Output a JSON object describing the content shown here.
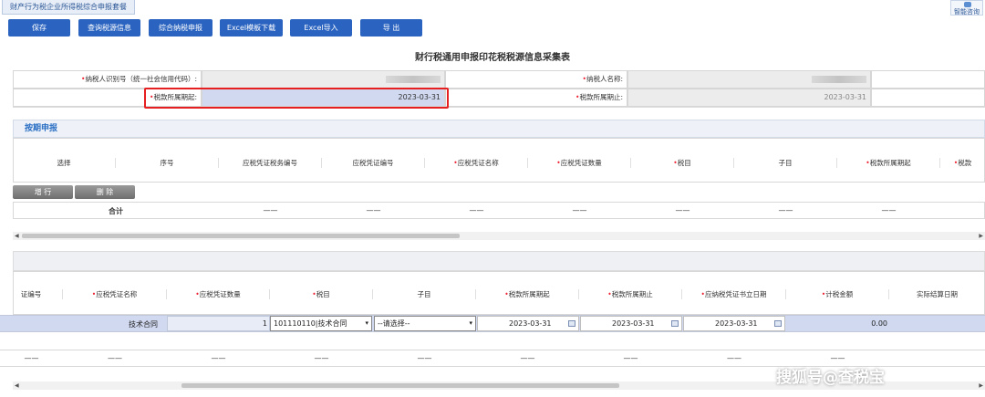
{
  "window": {
    "tab_title": "财产行为税企业所得税综合申报套餐",
    "assist_label": "智能咨询"
  },
  "toolbar": [
    {
      "label": "保存"
    },
    {
      "label": "查询税源信息"
    },
    {
      "label": "综合纳税申报"
    },
    {
      "label": "Excel模板下载"
    },
    {
      "label": "Excel导入"
    },
    {
      "label": "导 出"
    }
  ],
  "form": {
    "title": "财行税通用申报印花税税源信息采集表",
    "taxpayer_id_label": "纳税人识别号（统一社会信用代码）:",
    "taxpayer_name_label": "纳税人名称:",
    "period_start_label": "税款所属期起:",
    "period_start_value": "2023-03-31",
    "period_end_label": "税款所属期止:",
    "period_end_value": "2023-03-31"
  },
  "section1": {
    "title": "按期申报",
    "headers": [
      "选择",
      "序号",
      "应税凭证税务编号",
      "应税凭证编号",
      "应税凭证名称",
      "应税凭证数量",
      "税目",
      "子目",
      "税款所属期起",
      "税款"
    ],
    "add_button": "增 行",
    "delete_button": "删 除",
    "total_label": "合计",
    "dash": "——"
  },
  "section2": {
    "headers": [
      "证编号",
      "应税凭证名称",
      "应税凭证数量",
      "税目",
      "子目",
      "税款所属期起",
      "税款所属期止",
      "应纳税凭证书立日期",
      "计税金额",
      "实际结算日期"
    ],
    "row": {
      "voucher_name": "技术合同",
      "voucher_count": "1",
      "tax_item": "101110110|技术合同",
      "sub_item": "--请选择--",
      "period_start": "2023-03-31",
      "period_end": "2023-03-31",
      "signing_date": "2023-03-31",
      "tax_amount": "0.00"
    },
    "dash": "——"
  },
  "watermark": "搜狐号@查税宝",
  "colors": {
    "primary": "#2b64c0",
    "highlight": "#e62020",
    "row_highlight": "#d0d9f0"
  }
}
